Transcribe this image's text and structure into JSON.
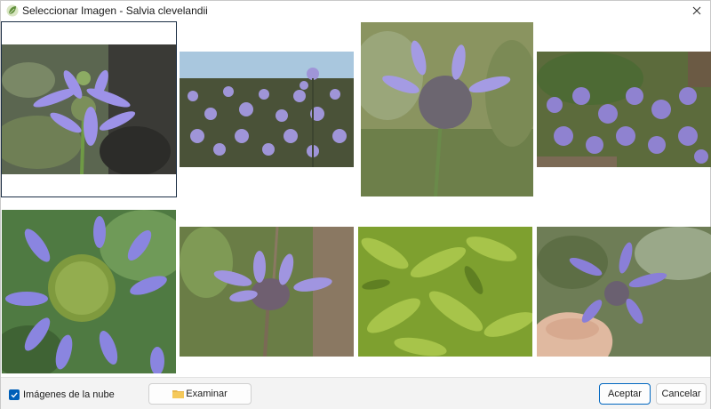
{
  "window": {
    "title": "Seleccionar Imagen - Salvia clevelandii"
  },
  "gallery": {
    "images": [
      {
        "name": "image-1",
        "subject": "flower-closeup",
        "selected": true
      },
      {
        "name": "image-2",
        "subject": "field-of-flowers",
        "selected": false
      },
      {
        "name": "image-3",
        "subject": "flower-head-closeup",
        "selected": false
      },
      {
        "name": "image-4",
        "subject": "hillside-shrubs",
        "selected": false
      },
      {
        "name": "image-5",
        "subject": "flower-head-top-view",
        "selected": false
      },
      {
        "name": "image-6",
        "subject": "flower-head-side",
        "selected": false
      },
      {
        "name": "image-7",
        "subject": "green-leaves",
        "selected": false
      },
      {
        "name": "image-8",
        "subject": "flower-in-hand",
        "selected": false
      }
    ]
  },
  "footer": {
    "cloud_checkbox_label": "Imágenes de la nube",
    "cloud_checkbox_checked": true,
    "browse_label": "Examinar",
    "accept_label": "Aceptar",
    "cancel_label": "Cancelar"
  },
  "colors": {
    "accent": "#005fb8",
    "selection_border": "#1c2f45",
    "flower_purple": "#8c7fd6",
    "foliage_green": "#6f8f4a"
  }
}
